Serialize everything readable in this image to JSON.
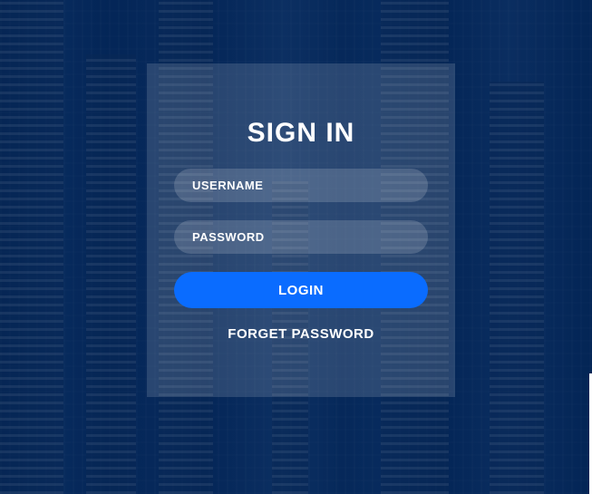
{
  "login_form": {
    "title": "SIGN IN",
    "username_placeholder": "USERNAME",
    "password_placeholder": "PASSWORD",
    "login_label": "LOGIN",
    "forget_password_label": "FORGET PASSWORD"
  },
  "colors": {
    "background": "#062a5c",
    "panel": "rgba(255,255,255,0.14)",
    "login_button": "#0a6cff",
    "text": "#ffffff"
  }
}
